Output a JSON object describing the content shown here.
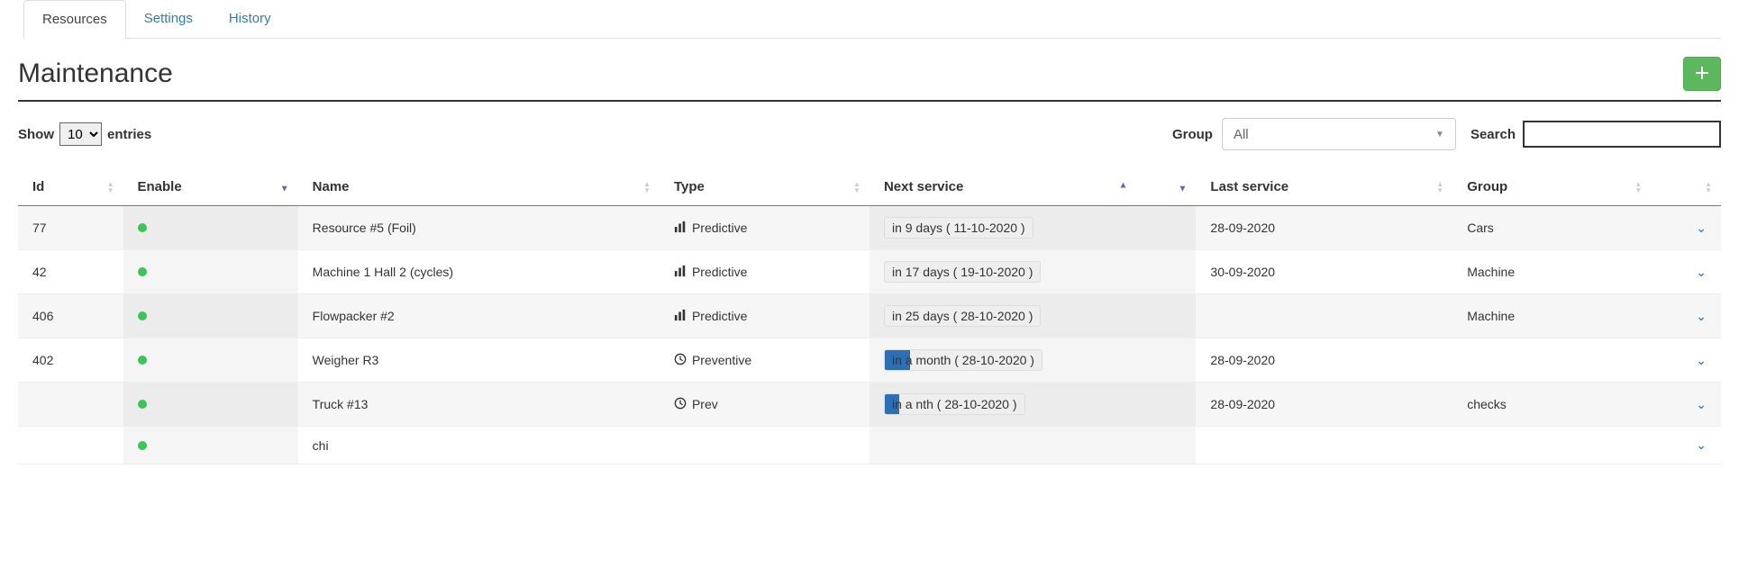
{
  "tabs": {
    "resources": "Resources",
    "settings": "Settings",
    "history": "History"
  },
  "title": "Maintenance",
  "controls": {
    "show": "Show",
    "entries_count": "10",
    "entries": "entries",
    "group_label": "Group",
    "group_value": "All",
    "search_label": "Search",
    "search_value": ""
  },
  "columns": {
    "id": "Id",
    "enable": "Enable",
    "name": "Name",
    "type": "Type",
    "next": "Next service",
    "last": "Last service",
    "group": "Group"
  },
  "type_labels": {
    "predictive": "Predictive",
    "preventive": "Preventive",
    "prev_cut": "Prev"
  },
  "rows": [
    {
      "id": "77",
      "enable": true,
      "name": "Resource #5 (Foil)",
      "type": "predictive",
      "next": "in 9 days ( 11-10-2020 )",
      "hl": 0,
      "last": "28-09-2020",
      "group": "Cars"
    },
    {
      "id": "42",
      "enable": true,
      "name": "Machine 1 Hall 2 (cycles)",
      "type": "predictive",
      "next": "in 17 days ( 19-10-2020 )",
      "hl": 0,
      "last": "30-09-2020",
      "group": "Machine"
    },
    {
      "id": "406",
      "enable": true,
      "name": "Flowpacker #2",
      "type": "predictive",
      "next": "in 25 days ( 28-10-2020 )",
      "hl": 0,
      "last": "",
      "group": "Machine"
    },
    {
      "id": "402",
      "enable": true,
      "name": "Weigher R3",
      "type": "preventive",
      "next": "in a month ( 28-10-2020 )",
      "hl": 28,
      "last": "28-09-2020",
      "group": ""
    },
    {
      "id": "",
      "enable": true,
      "name": "Truck #13",
      "type": "prev_cut",
      "next": "in a     nth ( 28-10-2020 )",
      "hl": 16,
      "last": "28-09-2020",
      "group": "checks",
      "partial": true
    },
    {
      "id": "",
      "enable": true,
      "name": "chi",
      "type": "",
      "next": "",
      "hl": 0,
      "last": "",
      "group": "",
      "partial": true
    }
  ]
}
